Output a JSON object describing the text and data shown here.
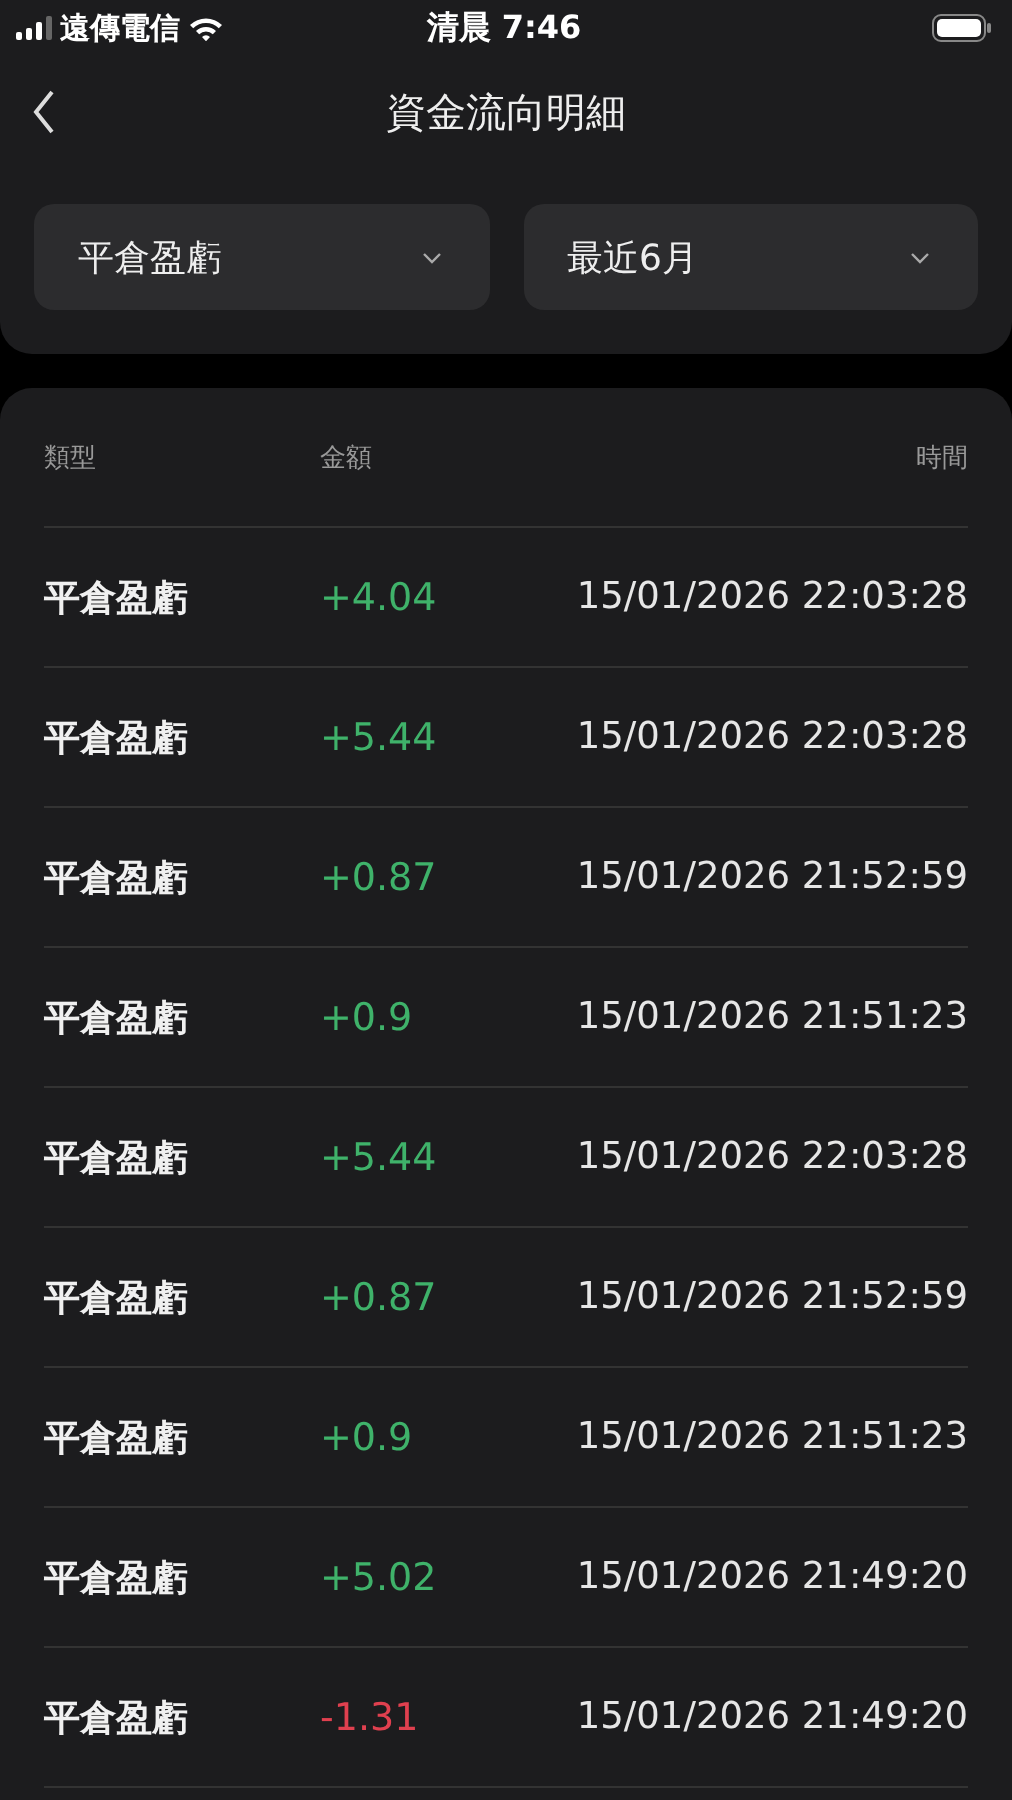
{
  "status_bar": {
    "carrier": "遠傳電信",
    "time": "清晨 7:46"
  },
  "nav": {
    "title": "資金流向明細"
  },
  "filters": [
    {
      "label": "平倉盈虧"
    },
    {
      "label": "最近6月"
    }
  ],
  "table": {
    "columns": [
      "類型",
      "金額",
      "時間"
    ],
    "rows": [
      {
        "type": "平倉盈虧",
        "amount": "+4.04",
        "color": "#3fb26a",
        "time": "15/01/2026 22:03:28"
      },
      {
        "type": "平倉盈虧",
        "amount": "+5.44",
        "color": "#3fb26a",
        "time": "15/01/2026 22:03:28"
      },
      {
        "type": "平倉盈虧",
        "amount": "+0.87",
        "color": "#3fb26a",
        "time": "15/01/2026 21:52:59"
      },
      {
        "type": "平倉盈虧",
        "amount": "+0.9",
        "color": "#3fb26a",
        "time": "15/01/2026 21:51:23"
      },
      {
        "type": "平倉盈虧",
        "amount": "+5.44",
        "color": "#3fb26a",
        "time": "15/01/2026 22:03:28"
      },
      {
        "type": "平倉盈虧",
        "amount": "+0.87",
        "color": "#3fb26a",
        "time": "15/01/2026 21:52:59"
      },
      {
        "type": "平倉盈虧",
        "amount": "+0.9",
        "color": "#3fb26a",
        "time": "15/01/2026 21:51:23"
      },
      {
        "type": "平倉盈虧",
        "amount": "+5.02",
        "color": "#3fb26a",
        "time": "15/01/2026 21:49:20"
      },
      {
        "type": "平倉盈虧",
        "amount": "-1.31",
        "color": "#e0404f",
        "time": "15/01/2026 21:49:20"
      }
    ]
  }
}
